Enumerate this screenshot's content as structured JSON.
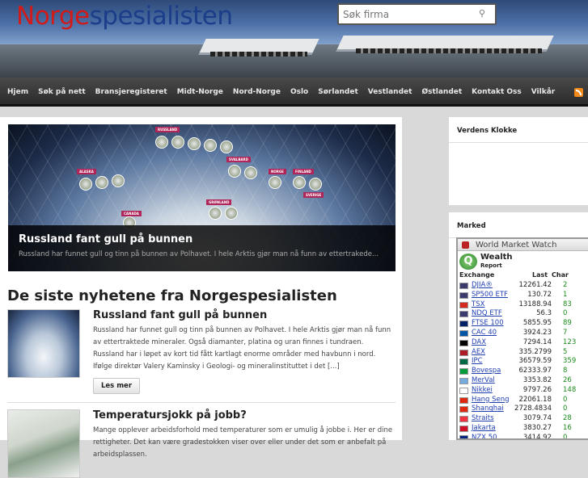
{
  "header": {
    "logo_part1": "Norge",
    "logo_part2": "spesialisten",
    "search_placeholder": "Søk firma",
    "search_icon": "magnifier-icon"
  },
  "nav": {
    "items": [
      "Hjem",
      "Søk på nett",
      "Bransjeregisteret",
      "Midt-Norge",
      "Nord-Norge",
      "Oslo",
      "Sørlandet",
      "Vestlandet",
      "Østlandet",
      "Kontakt Oss",
      "Vilkår"
    ],
    "rss_icon": "rss-icon"
  },
  "feature": {
    "labels": [
      "RUSSLAND",
      "ALASKA",
      "CANADA",
      "SVALBARD",
      "NORGE",
      "FINLAND",
      "SVERIGE",
      "GRØNLAND"
    ],
    "title": "Russland fant gull på bunnen",
    "excerpt": "Russland har funnet gull og tinn på bunnen av Polhavet. I hele Arktis gjør man nå funn av ettertrakede..."
  },
  "section_title": "De siste nyhetene fra Norgespesialisten",
  "posts": [
    {
      "title": "Russland fant gull på bunnen",
      "excerpt": "Russland har funnet gull og tinn på bunnen av Polhavet. I hele Arktis gjør man nå funn av ettertraktede mineraler. Også diamanter, platina og uran finnes i tundraen. Russland har i løpet av kort tid fått kartlagt enorme områder med havbunn i nord. Ifølge direktør Valery Kaminsky i Geologi- og mineralinstituttet i det [...]",
      "more": "Les mer"
    },
    {
      "title": "Temperatursjokk på jobb?",
      "excerpt": "Mange opplever arbeidsforhold med temperaturer som er umulig å jobbe i. Her er dine rettigheter. Det kan være gradestokken viser over eller under det som er anbefalt på arbeidsplassen."
    }
  ],
  "sidebar": {
    "clock_title": "Verdens Klokke",
    "market_title": "Marked",
    "widget": {
      "title": "World Market Watch",
      "brand": "Wealth",
      "brand_sub": "Report",
      "col_exchange": "Exchange",
      "col_last": "Last",
      "col_change": "Char",
      "rows": [
        {
          "name": "DJIA®",
          "last": "12261.42",
          "chg": "2",
          "flag": "#3c3b6e"
        },
        {
          "name": "SP500 ETF",
          "last": "130.72",
          "chg": "1",
          "flag": "#3c3b6e"
        },
        {
          "name": "TSX",
          "last": "13188.94",
          "chg": "83",
          "flag": "#d52b1e"
        },
        {
          "name": "NDQ ETF",
          "last": "56.3",
          "chg": "0",
          "flag": "#3c3b6e"
        },
        {
          "name": "FTSE 100",
          "last": "5855.95",
          "chg": "89",
          "flag": "#012169"
        },
        {
          "name": "CAC 40",
          "last": "3924.23",
          "chg": "7",
          "flag": "#0055a4"
        },
        {
          "name": "DAX",
          "last": "7294.14",
          "chg": "123",
          "flag": "#000000"
        },
        {
          "name": "AEX",
          "last": "335.2799",
          "chg": "5",
          "flag": "#ae1c28"
        },
        {
          "name": "IPC",
          "last": "36579.59",
          "chg": "359",
          "flag": "#006847"
        },
        {
          "name": "Bovespa",
          "last": "62333.97",
          "chg": "8",
          "flag": "#009c3b"
        },
        {
          "name": "MerVal",
          "last": "3353.82",
          "chg": "26",
          "flag": "#74acdf"
        },
        {
          "name": "Nikkei",
          "last": "9797.26",
          "chg": "148",
          "flag": "#ffffff"
        },
        {
          "name": "Hang Seng",
          "last": "22061.18",
          "chg": "0",
          "flag": "#de2910"
        },
        {
          "name": "Shanghai",
          "last": "2728.4834",
          "chg": "0",
          "flag": "#de2910"
        },
        {
          "name": "Straits",
          "last": "3079.74",
          "chg": "28",
          "flag": "#ef3340"
        },
        {
          "name": "Jakarta",
          "last": "3830.27",
          "chg": "16",
          "flag": "#ce1126"
        },
        {
          "name": "NZX 50",
          "last": "3414.92",
          "chg": "0",
          "flag": "#00247d"
        }
      ]
    }
  }
}
